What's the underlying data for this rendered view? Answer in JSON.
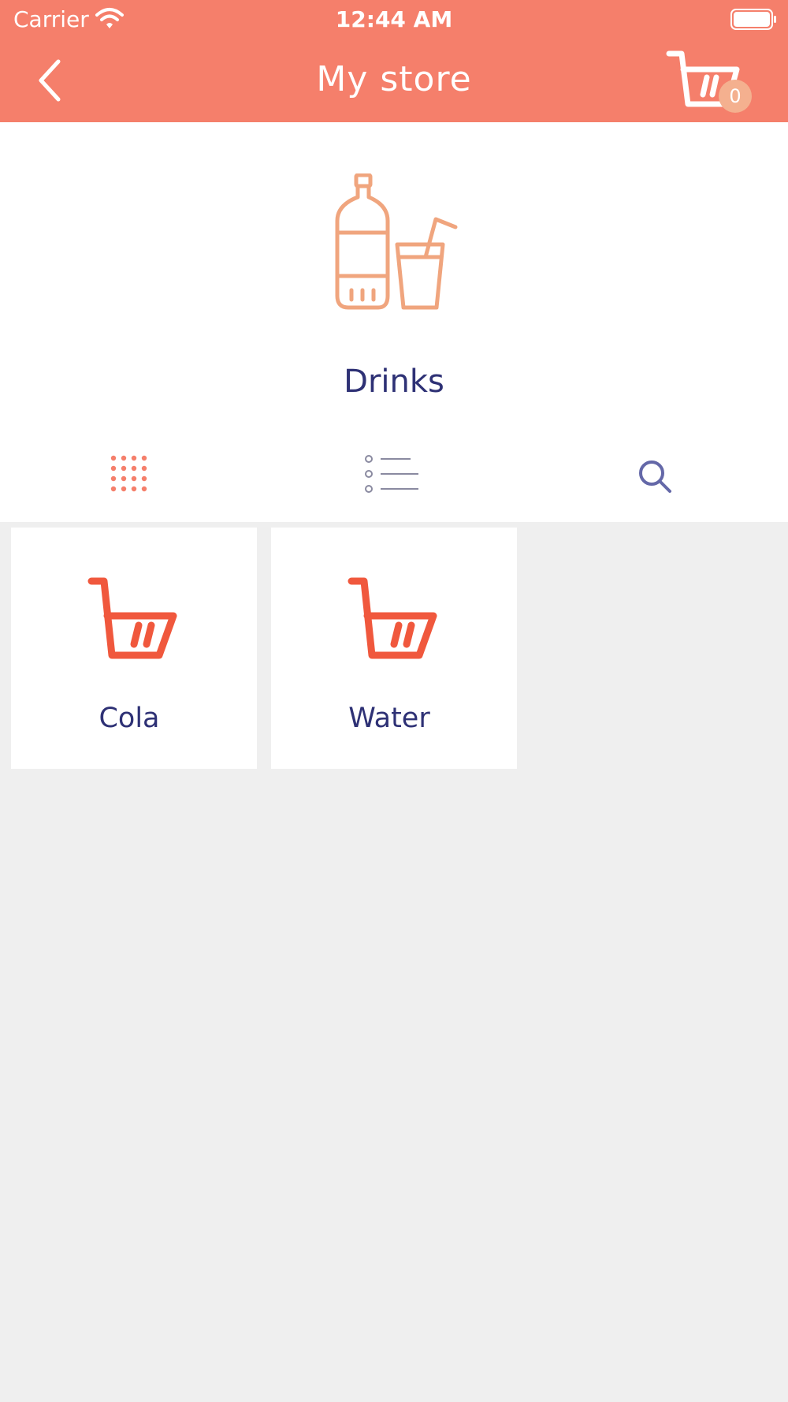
{
  "status_bar": {
    "carrier": "Carrier",
    "time": "12:44 AM"
  },
  "nav": {
    "title": "My store",
    "cart_count": "0",
    "back_icon": "chevron-left-icon",
    "cart_icon": "shopping-cart-icon"
  },
  "category": {
    "name": "Drinks",
    "icon": "drinks-icon"
  },
  "view_options": {
    "grid_icon": "grid-view-icon",
    "list_icon": "list-view-icon",
    "search_icon": "search-icon",
    "selected": "grid"
  },
  "products": [
    {
      "name": "Cola",
      "icon": "shopping-cart-icon"
    },
    {
      "name": "Water",
      "icon": "shopping-cart-icon"
    }
  ],
  "colors": {
    "header": "#f57f6b",
    "accent": "#f0583d",
    "category_icon": "#f0a57e",
    "text": "#2e3175",
    "background": "#efefef"
  }
}
